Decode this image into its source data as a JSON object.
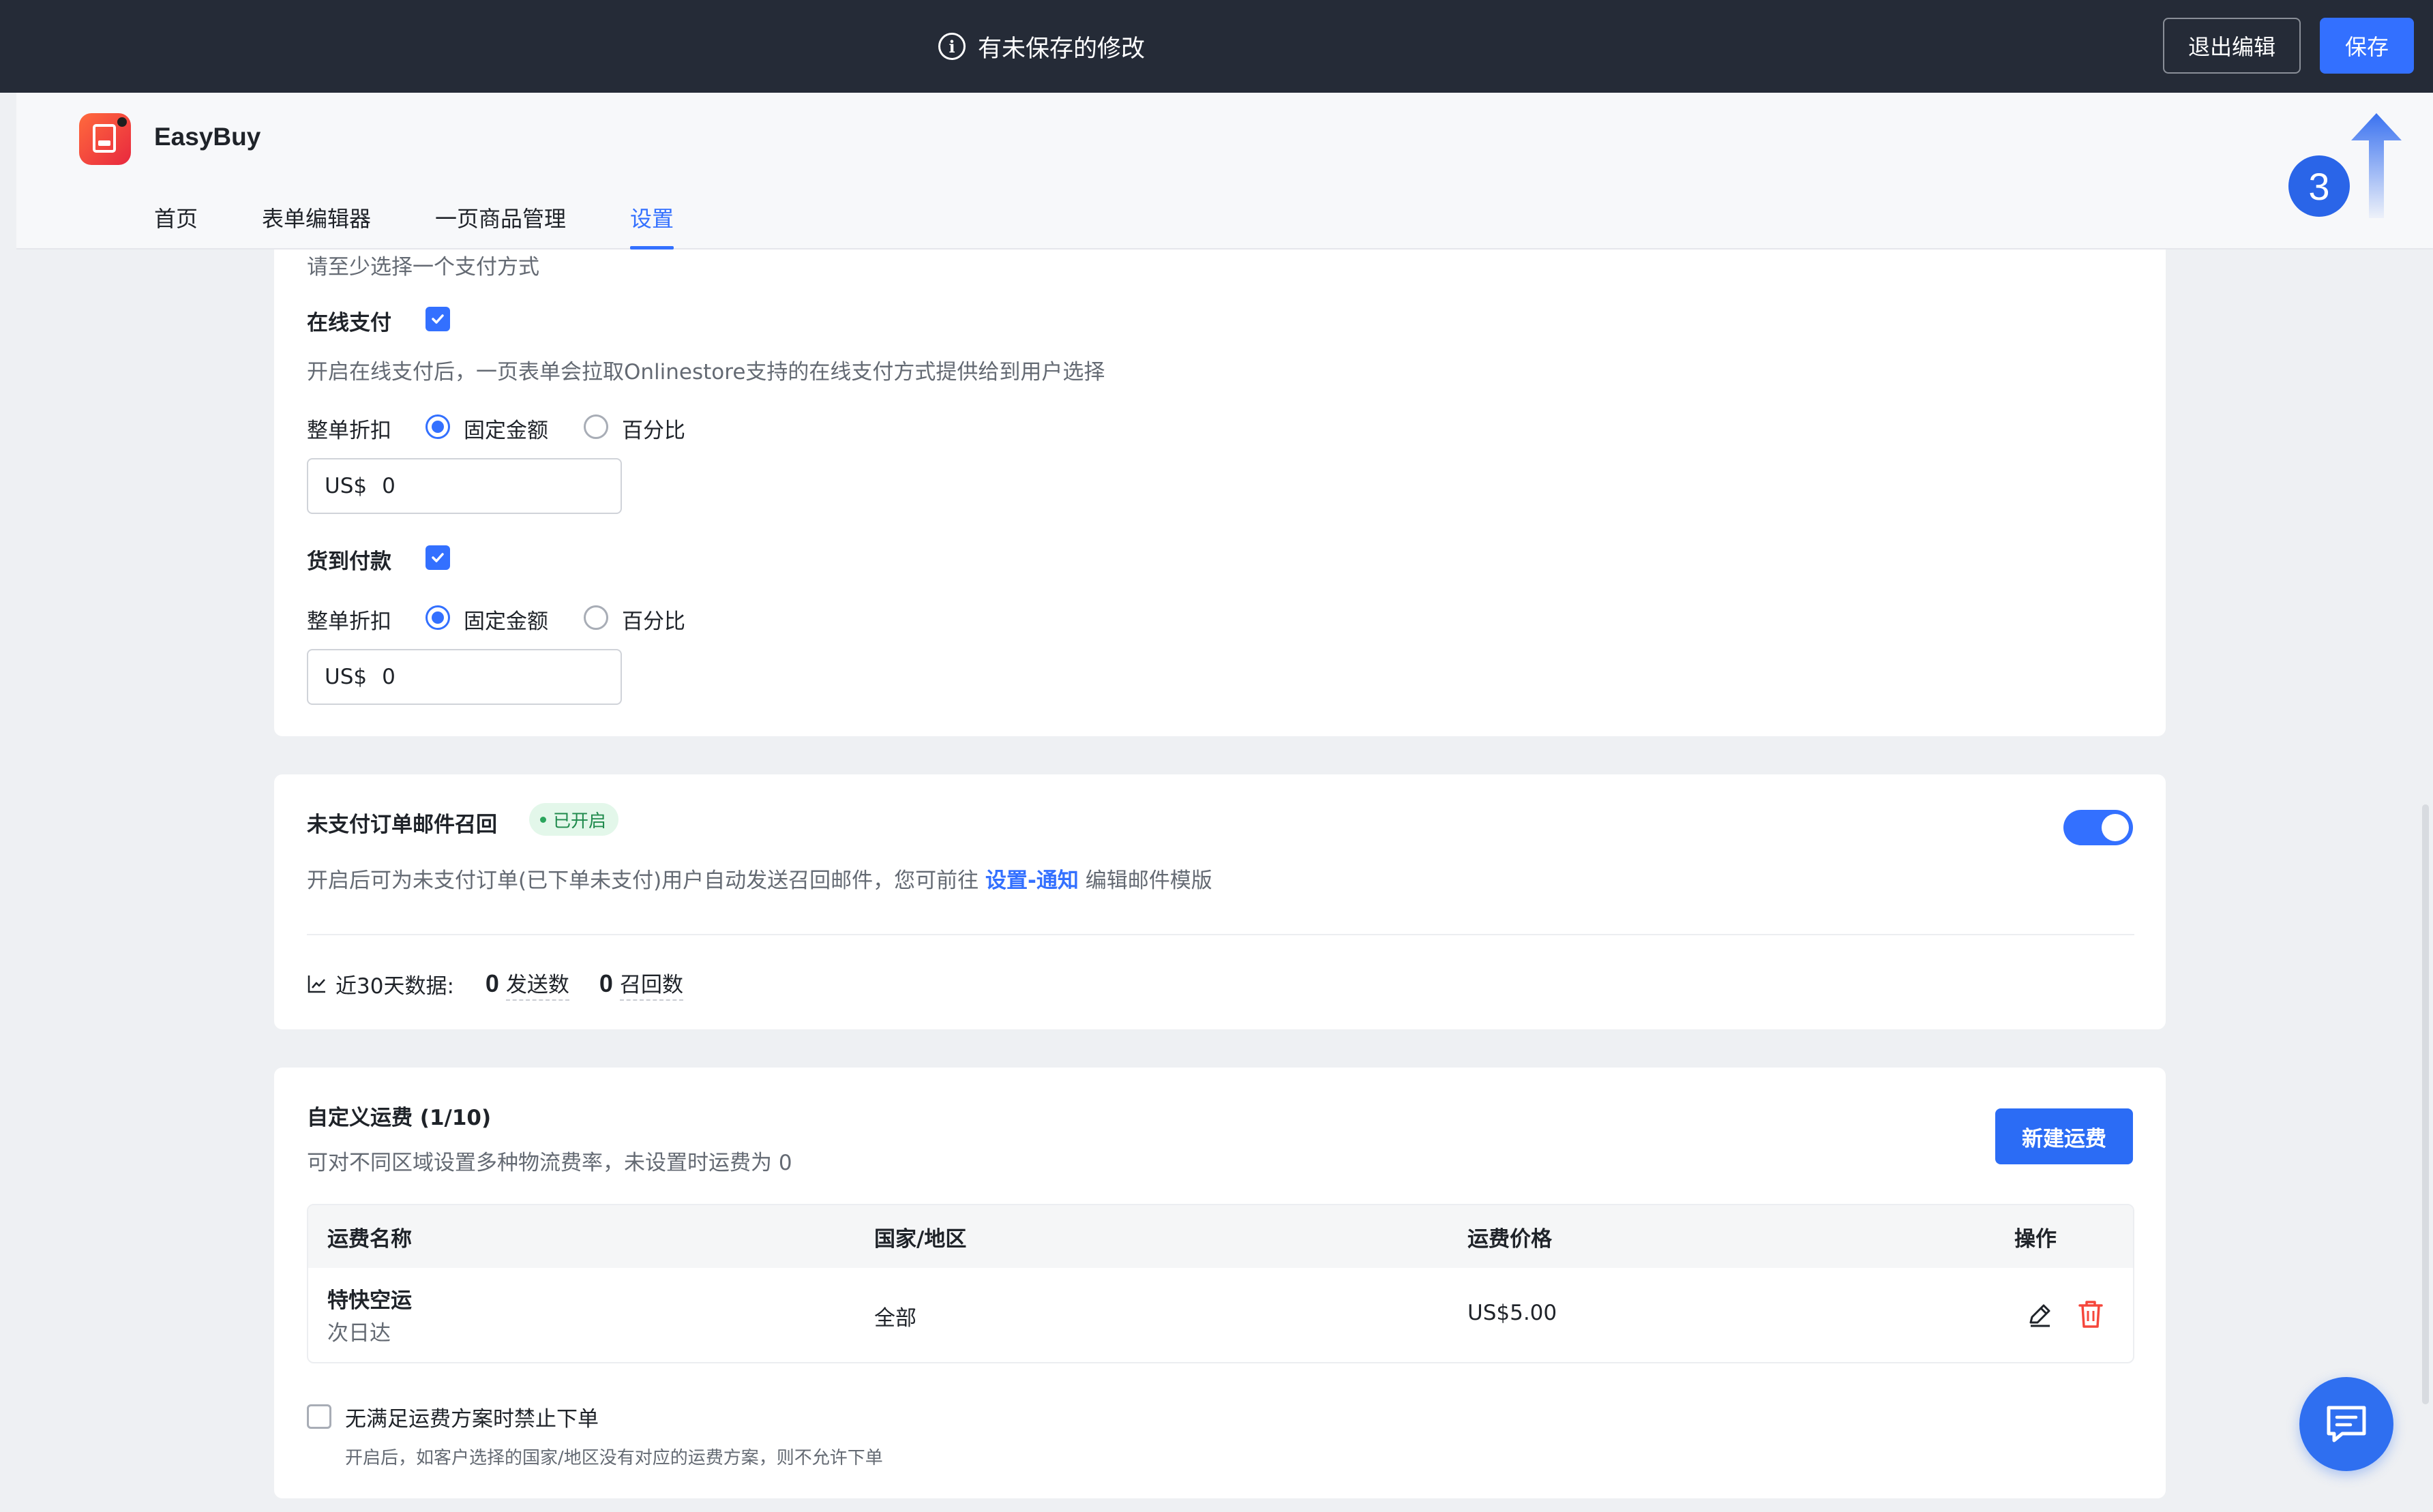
{
  "topbar": {
    "unsaved_message": "有未保存的修改",
    "exit_label": "退出编辑",
    "save_label": "保存"
  },
  "app": {
    "name": "EasyBuy",
    "nav": [
      "首页",
      "表单编辑器",
      "一页商品管理",
      "设置"
    ],
    "active_nav": "设置"
  },
  "annotation": {
    "step": "3"
  },
  "payment": {
    "min_hint": "请至少选择一个支付方式",
    "online": {
      "label": "在线支付",
      "checked": true,
      "desc": "开启在线支付后，一页表单会拉取Onlinestore支持的在线支付方式提供给到用户选择",
      "discount_label": "整单折扣",
      "option_fixed": "固定金额",
      "option_percent": "百分比",
      "currency": "US$",
      "value": "0"
    },
    "cod": {
      "label": "货到付款",
      "checked": true,
      "discount_label": "整单折扣",
      "option_fixed": "固定金额",
      "option_percent": "百分比",
      "currency": "US$",
      "value": "0"
    }
  },
  "recall": {
    "title": "未支付订单邮件召回",
    "status": "已开启",
    "enabled": true,
    "desc_prefix": "开启后可为未支付订单(已下单未支付)用户自动发送召回邮件，您可前往",
    "desc_link": "设置-通知",
    "desc_suffix": "编辑邮件模版",
    "stats_label": "近30天数据:",
    "sent_value": "0",
    "sent_label": "发送数",
    "recalled_value": "0",
    "recalled_label": "召回数"
  },
  "shipping": {
    "title": "自定义运费 (1/10)",
    "desc": "可对不同区域设置多种物流费率，未设置时运费为 0",
    "new_button": "新建运费",
    "columns": [
      "运费名称",
      "国家/地区",
      "运费价格",
      "操作"
    ],
    "rows": [
      {
        "name": "特快空运",
        "sub": "次日达",
        "region": "全部",
        "price": "US$5.00"
      }
    ],
    "block_label": "无满足运费方案时禁止下单",
    "block_checked": false,
    "block_desc": "开启后，如客户选择的国家/地区没有对应的运费方案，则不允许下单"
  },
  "colors": {
    "primary": "#3370ff",
    "topbar": "#252b37",
    "danger": "#f5473c",
    "success": "#1f8a4c"
  }
}
